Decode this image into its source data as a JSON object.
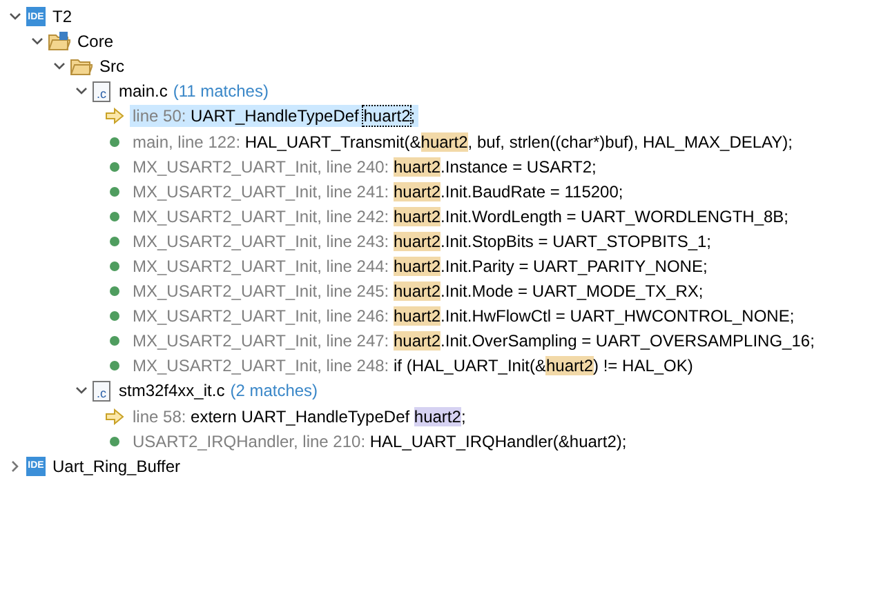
{
  "tree": [
    {
      "kind": "project",
      "badge": "IDE",
      "label": "T2",
      "expanded": true,
      "children": [
        {
          "kind": "source-folder",
          "label": "Core",
          "expanded": true,
          "children": [
            {
              "kind": "folder",
              "label": "Src",
              "expanded": true,
              "children": [
                {
                  "kind": "file",
                  "icon_text": ".c",
                  "label": "main.c",
                  "count": "(11 matches)",
                  "expanded": true,
                  "children": [
                    {
                      "kind": "declaration",
                      "selected": true,
                      "location": "line 50:",
                      "before": "UART_HandleTypeDef ",
                      "match": "huart2",
                      "after": ";"
                    },
                    {
                      "kind": "reference",
                      "selected": false,
                      "location": "main, line 122:",
                      "before": "HAL_UART_Transmit(&",
                      "match": "huart2",
                      "after": ", buf, strlen((char*)buf), HAL_MAX_DELAY);",
                      "color": "#f2d9a8"
                    },
                    {
                      "kind": "reference",
                      "selected": false,
                      "location": "MX_USART2_UART_Init, line 240:",
                      "match": "huart2",
                      "after": ".Instance = USART2;",
                      "color": "#f2d9a8"
                    },
                    {
                      "kind": "reference",
                      "selected": false,
                      "location": "MX_USART2_UART_Init, line 241:",
                      "match": "huart2",
                      "after": ".Init.BaudRate = 115200;",
                      "color": "#f2d9a8"
                    },
                    {
                      "kind": "reference",
                      "selected": false,
                      "location": "MX_USART2_UART_Init, line 242:",
                      "match": "huart2",
                      "after": ".Init.WordLength = UART_WORDLENGTH_8B;",
                      "color": "#f2d9a8"
                    },
                    {
                      "kind": "reference",
                      "selected": false,
                      "location": "MX_USART2_UART_Init, line 243:",
                      "match": "huart2",
                      "after": ".Init.StopBits = UART_STOPBITS_1;",
                      "color": "#f2d9a8"
                    },
                    {
                      "kind": "reference",
                      "selected": false,
                      "location": "MX_USART2_UART_Init, line 244:",
                      "match": "huart2",
                      "after": ".Init.Parity = UART_PARITY_NONE;",
                      "color": "#f2d9a8"
                    },
                    {
                      "kind": "reference",
                      "selected": false,
                      "location": "MX_USART2_UART_Init, line 245:",
                      "match": "huart2",
                      "after": ".Init.Mode = UART_MODE_TX_RX;",
                      "color": "#f2d9a8"
                    },
                    {
                      "kind": "reference",
                      "selected": false,
                      "location": "MX_USART2_UART_Init, line 246:",
                      "match": "huart2",
                      "after": ".Init.HwFlowCtl = UART_HWCONTROL_NONE;",
                      "color": "#f2d9a8"
                    },
                    {
                      "kind": "reference",
                      "selected": false,
                      "location": "MX_USART2_UART_Init, line 247:",
                      "match": "huart2",
                      "after": ".Init.OverSampling = UART_OVERSAMPLING_16;",
                      "color": "#f2d9a8"
                    },
                    {
                      "kind": "reference",
                      "selected": false,
                      "location": "MX_USART2_UART_Init, line 248:",
                      "before": "if (HAL_UART_Init(&",
                      "match": "huart2",
                      "after": ") != HAL_OK)",
                      "color": "#f2d9a8"
                    }
                  ]
                },
                {
                  "kind": "file",
                  "icon_text": ".c",
                  "label": "stm32f4xx_it.c",
                  "count": "(2 matches)",
                  "expanded": true,
                  "children": [
                    {
                      "kind": "declaration",
                      "selected": false,
                      "location": "line 58:",
                      "before": "extern UART_HandleTypeDef ",
                      "match": "huart2",
                      "after": ";",
                      "color": "#d6d2f2"
                    },
                    {
                      "kind": "reference",
                      "selected": false,
                      "location": "USART2_IRQHandler, line 210:",
                      "before": "HAL_UART_IRQHandler(&",
                      "match": "huart2",
                      "after": ");"
                    }
                  ]
                }
              ]
            }
          ]
        }
      ]
    },
    {
      "kind": "project",
      "badge": "IDE",
      "label": "Uart_Ring_Buffer",
      "expanded": false
    }
  ]
}
